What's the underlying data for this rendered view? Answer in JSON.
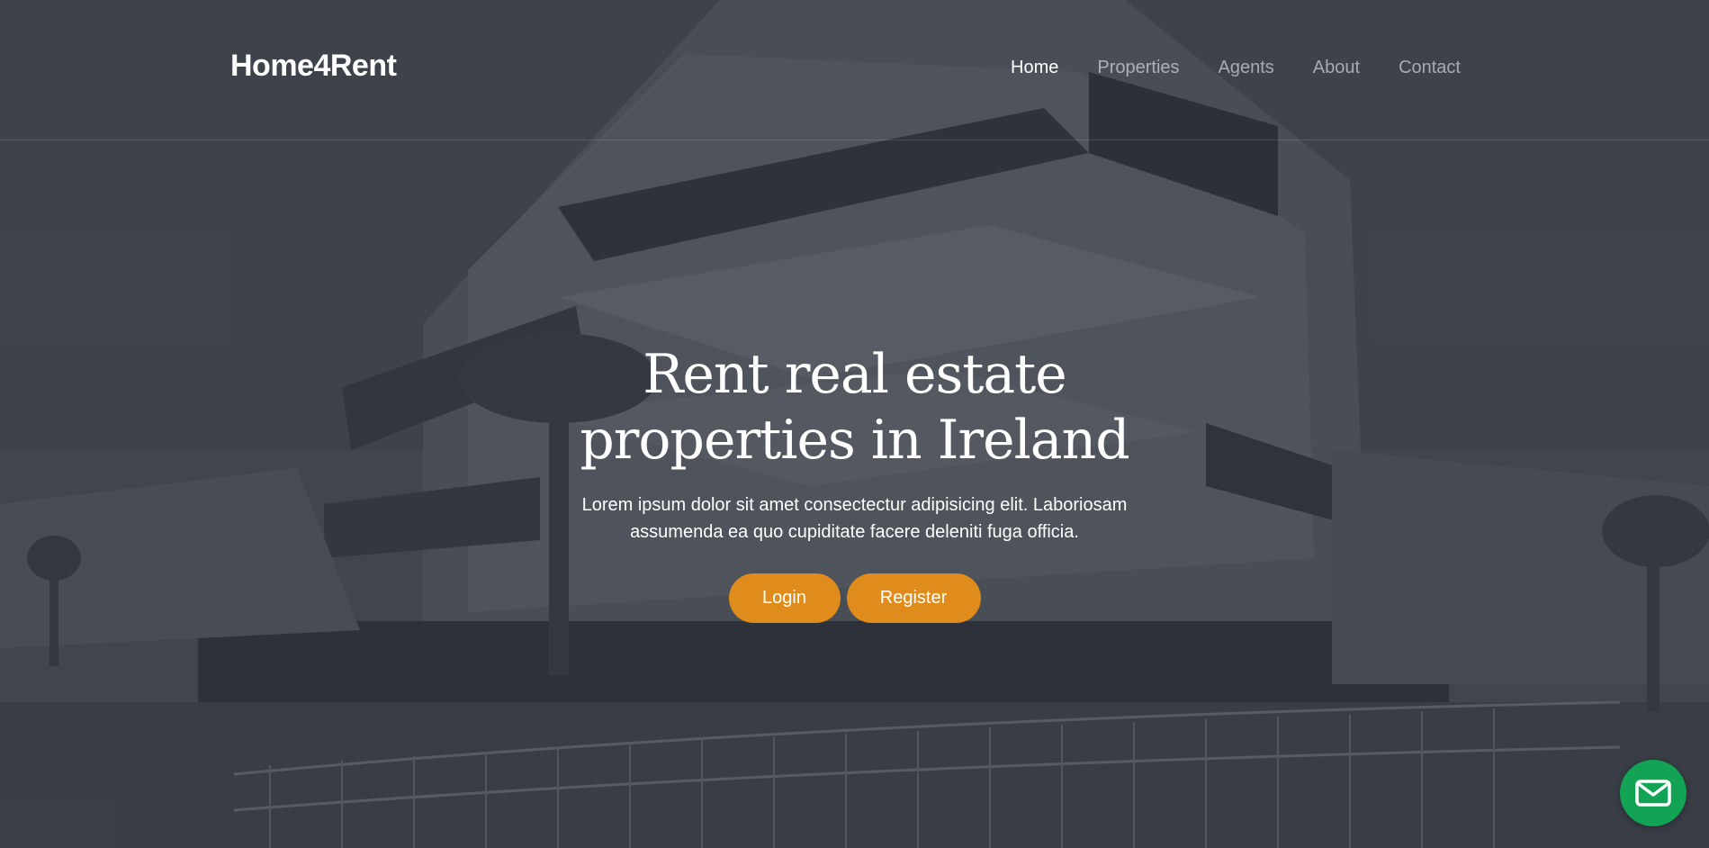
{
  "brand": {
    "name": "Home4Rent"
  },
  "nav": {
    "items": [
      {
        "label": "Home",
        "active": true
      },
      {
        "label": "Properties",
        "active": false
      },
      {
        "label": "Agents",
        "active": false
      },
      {
        "label": "About",
        "active": false
      },
      {
        "label": "Contact",
        "active": false
      }
    ]
  },
  "hero": {
    "title_line1": "Rent real estate",
    "title_line2": "properties in Ireland",
    "subtitle": "Lorem ipsum dolor sit amet consectectur adipisicing elit. Laboriosam assumenda ea quo cupiditate facere deleniti fuga officia.",
    "login_label": "Login",
    "register_label": "Register"
  },
  "fab": {
    "icon": "mail-icon"
  },
  "colors": {
    "accent": "#e08c1c",
    "fab": "#12a454",
    "overlay": "#2c3038"
  }
}
